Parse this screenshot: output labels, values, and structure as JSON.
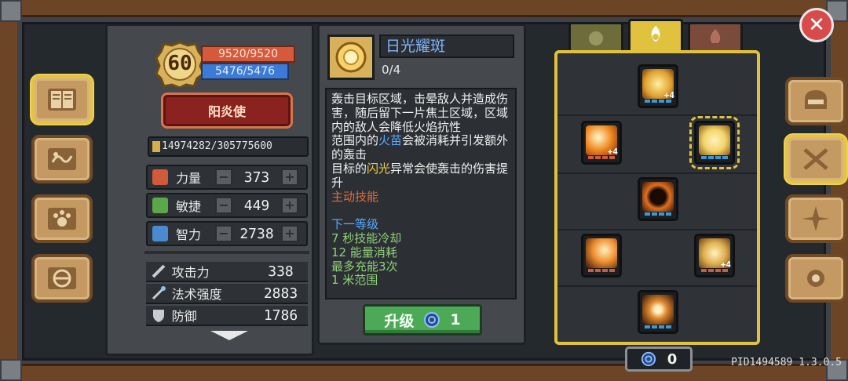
{
  "player": {
    "level": "60",
    "hp": "9520/9520",
    "mp": "5476/5476",
    "class_name": "阳炎使",
    "xp": "14974282/305775600",
    "xp_fraction": 0.049
  },
  "stats": [
    {
      "label": "力量",
      "value": "373",
      "icon": "fist-icon",
      "color": "#d05a3a"
    },
    {
      "label": "敏捷",
      "value": "449",
      "icon": "feather-icon",
      "color": "#5aa84a"
    },
    {
      "label": "智力",
      "value": "2738",
      "icon": "book-icon",
      "color": "#4a8ad0"
    }
  ],
  "attributes": [
    {
      "label": "攻击力",
      "value": "338",
      "icon": "sword-icon"
    },
    {
      "label": "法术强度",
      "value": "2883",
      "icon": "wand-icon"
    },
    {
      "label": "防御",
      "value": "1786",
      "icon": "shield-icon"
    }
  ],
  "skill": {
    "name": "日光耀斑",
    "level": "0/4",
    "desc_1": "轰击目标区域，击晕敌人并造成伤害，随后留下一片焦土区域，区域内的敌人会降低火焰抗性",
    "desc_2a": "范围内的",
    "desc_2b": "火苗",
    "desc_2c": "会被消耗并引发额外的轰击",
    "desc_3a": "目标的",
    "desc_3b": "闪光",
    "desc_3c": "异常会使轰击的伤害提升",
    "skill_type": "主动技能",
    "next_header": "下一等级",
    "next_1": "7 秒技能冷却",
    "next_2": "12 能量消耗",
    "next_3": "最多充能3次",
    "next_4": "1 米范围"
  },
  "upgrade": {
    "label": "升级",
    "cost": "1"
  },
  "currency": {
    "amount": "0"
  },
  "version": "PID1494589 1.3.0.5",
  "tabs": [
    {
      "name": "tab-gear",
      "icon": "gear-icon"
    },
    {
      "name": "tab-sun",
      "icon": "flame-swirl-icon"
    },
    {
      "name": "tab-fire",
      "icon": "fire-icon"
    }
  ],
  "skill_nodes": [
    {
      "plus": "+4"
    },
    {
      "plus": "+4"
    },
    {
      "plus": ""
    },
    {
      "plus": ""
    },
    {
      "plus": ""
    },
    {
      "plus": "+4"
    },
    {
      "plus": ""
    }
  ],
  "close_label": "✕"
}
